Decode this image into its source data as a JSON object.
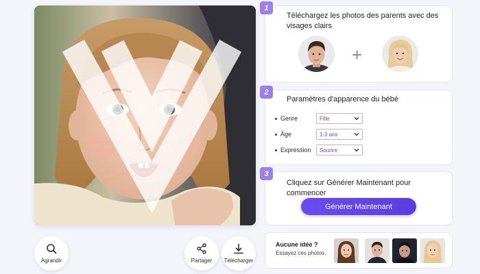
{
  "left": {
    "photo_alt": "",
    "buttons": {
      "zoom_label": "Agrandir",
      "share_label": "Partager",
      "download_label": "Télécharger"
    }
  },
  "step1": {
    "number": "1",
    "title": "Téléchargez les photos des parents avec des visages clairs",
    "plus": "+"
  },
  "step2": {
    "number": "2",
    "title": "Paramètres d'apparence du bébé",
    "params": [
      {
        "name": "Genre",
        "value": "Fille"
      },
      {
        "name": "Âge",
        "value": "1-3 ans"
      },
      {
        "name": "Expression",
        "value": "Sourire"
      }
    ]
  },
  "step3": {
    "number": "3",
    "title": "Cliquez sur Générer Maintenant pour commencer",
    "button_label": "Générer Maintenant"
  },
  "ideas": {
    "title": "Aucune idée ?",
    "subtitle": "Essayez ces photos."
  },
  "colors": {
    "accent": "#5a3de0",
    "badge": "#9b7ef0",
    "select_text": "#6a44d8",
    "background": "#f4f4fb"
  }
}
